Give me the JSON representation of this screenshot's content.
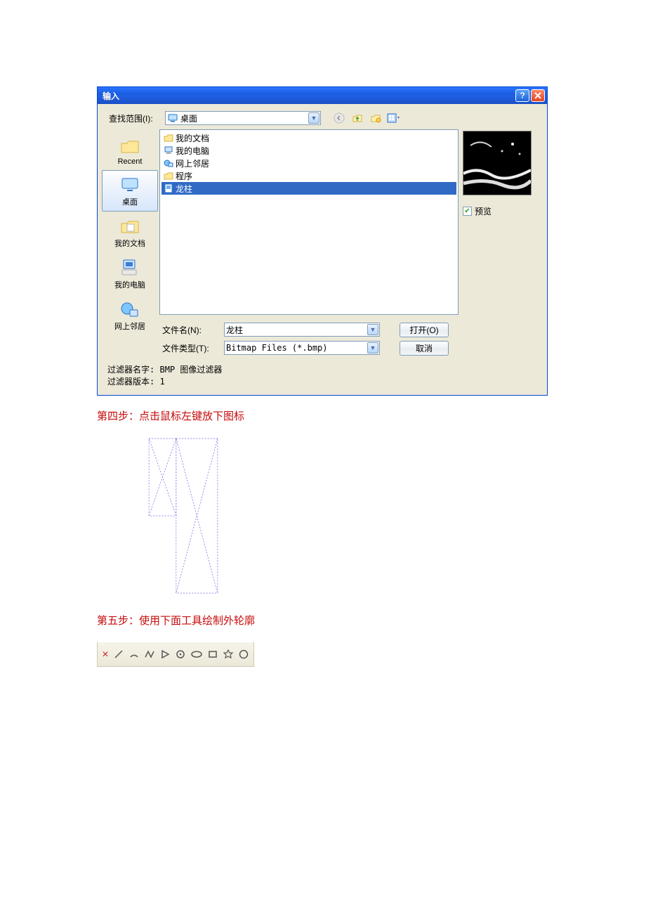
{
  "dialog": {
    "title": "输入",
    "look_in_label": "查找范围(I):",
    "look_in_value": "桌面",
    "sidebar": [
      {
        "label": "Recent",
        "icon": "folder-recent"
      },
      {
        "label": "桌面",
        "icon": "desktop",
        "selected": true
      },
      {
        "label": "我的文档",
        "icon": "my-documents"
      },
      {
        "label": "我的电脑",
        "icon": "my-computer"
      },
      {
        "label": "网上邻居",
        "icon": "network-places"
      }
    ],
    "items": [
      {
        "label": "我的文档",
        "icon": "folder"
      },
      {
        "label": "我的电脑",
        "icon": "computer"
      },
      {
        "label": "网上邻居",
        "icon": "network"
      },
      {
        "label": "程序",
        "icon": "folder"
      },
      {
        "label": "龙柱",
        "icon": "bmp",
        "selected": true
      }
    ],
    "filename_label": "文件名(N):",
    "filename_value": "龙柱",
    "filetype_label": "文件类型(T):",
    "filetype_value": "Bitmap Files (*.bmp)",
    "open_btn": "打开(O)",
    "cancel_btn": "取消",
    "preview_label": "预览",
    "filter_name_label": "过滤器名字:",
    "filter_name_value": "BMP 图像过滤器",
    "filter_ver_label": "过滤器版本:",
    "filter_ver_value": "1"
  },
  "step4": "第四步：点击鼠标左键放下图标",
  "step5": "第五步：使用下面工具绘制外轮廓"
}
